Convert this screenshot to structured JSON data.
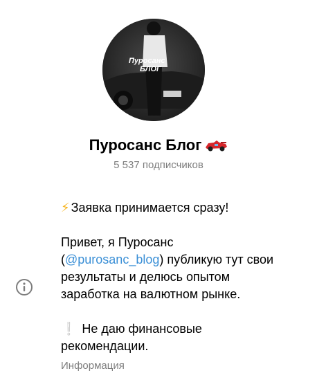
{
  "channel": {
    "title": "Пуросанс Блог",
    "subscribers": "5 537 подписчиков",
    "avatar_text_1": "Пуросанс",
    "avatar_text_2": "БЛОГ"
  },
  "description": {
    "line1_icon": "⚡",
    "line1_text": "Заявка принимается сразу!",
    "line2": "Привет, я Пуросанс",
    "line3_open": "(",
    "line3_mention": "@purosanc_blog",
    "line3_rest": ") публикую тут свои",
    "line4": "результаты и делюсь опытом",
    "line5": "заработка на валютном рынке.",
    "line6_icon": "❕",
    "line6_text": "Не даю финансовые",
    "line7": "рекомендации."
  },
  "info_label": "Информация",
  "icons": {
    "info": "info-circle-icon",
    "car": "race-car-icon"
  },
  "colors": {
    "link": "#3a8fd6",
    "secondary_text": "#7d7d7d"
  }
}
